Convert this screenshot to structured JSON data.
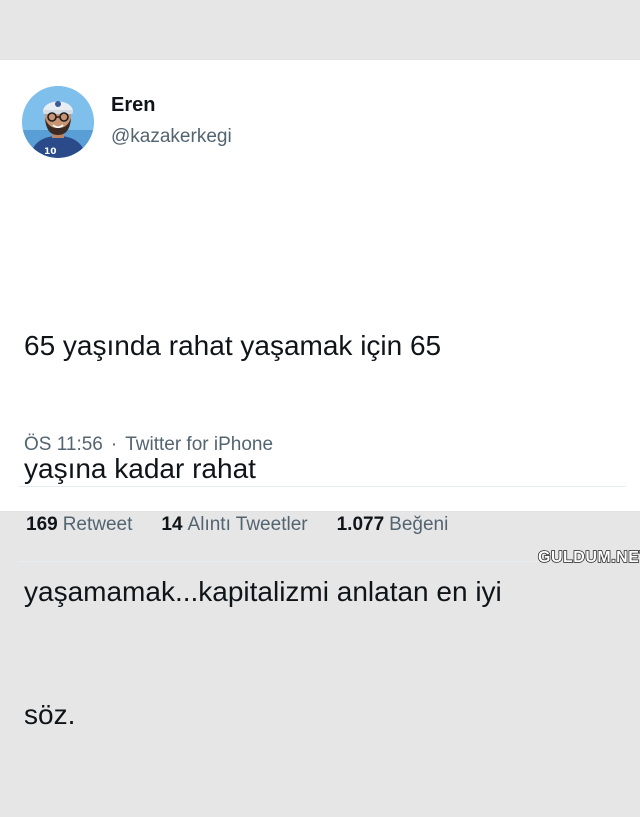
{
  "tweet": {
    "author": {
      "display_name": "Eren",
      "handle": "@kazakerkegi"
    },
    "text_lines": [
      "65 yaşında rahat yaşamak için 65",
      "yaşına kadar rahat",
      "yaşamamak...kapitalizmi anlatan en iyi",
      "söz."
    ],
    "time": "ÖS 11:56",
    "separator": "·",
    "source": "Twitter for iPhone",
    "stats": {
      "retweets": {
        "count": "169",
        "label": "Retweet"
      },
      "quotes": {
        "count": "14",
        "label": "Alıntı Tweetler"
      },
      "likes": {
        "count": "1.077",
        "label": "Beğeni"
      }
    }
  },
  "watermark": "GULDUM.NET",
  "colors": {
    "page_background": "#e6e6e6",
    "card_background": "#ffffff",
    "primary_text": "#0f1419",
    "secondary_text": "#536471",
    "divider": "#e6ecf0"
  }
}
